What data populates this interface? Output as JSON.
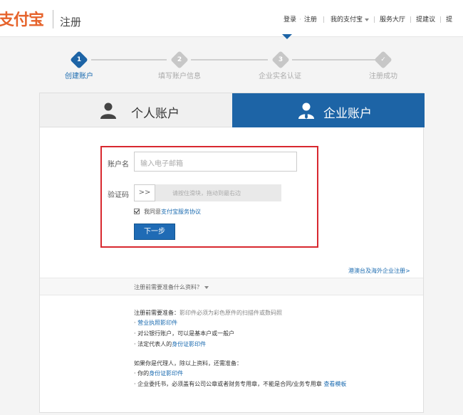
{
  "header": {
    "logo": "支付宝",
    "page_name": "注册",
    "nav": {
      "login": "登录",
      "register": "注册",
      "my_alipay": "我的支付宝",
      "service_hall": "服务大厅",
      "suggestion": "提建议",
      "cut": "提"
    }
  },
  "steps": [
    {
      "num": "1",
      "label": "创建账户",
      "state": "active"
    },
    {
      "num": "2",
      "label": "填写账户信息",
      "state": "pending"
    },
    {
      "num": "3",
      "label": "企业实名认证",
      "state": "pending"
    },
    {
      "num": "✓",
      "label": "注册成功",
      "state": "pending"
    }
  ],
  "tabs": {
    "personal": "个人账户",
    "company": "企业账户"
  },
  "form": {
    "account_label": "账户名",
    "account_placeholder": "输入电子邮箱",
    "captcha_label": "验证码",
    "slider_handle": ">>",
    "slider_hint": "请按住滑块，拖动到最右边",
    "agree_prefix": "我同意",
    "agree_link": "支付宝服务协议",
    "agree_checked": true,
    "next_button": "下一步"
  },
  "links": {
    "overseas": "港澳台及海外企业注册>"
  },
  "prep": {
    "toggle": "注册前需要准备什么资料？",
    "title": "注册前需要准备：",
    "note": "影印件必须为彩色原件的扫描件或数码照",
    "item1": "营业执照影印件",
    "item2": "对公银行账户，可以是基本户或一般户",
    "item3_prefix": "法定代表人的",
    "item3_link": "身份证影印件",
    "agent_title": "如果你是代理人，除以上资料，还需准备：",
    "agent_item1_prefix": "你的",
    "agent_item1_link": "身份证影印件",
    "agent_item2": "企业委托书，必须盖有公司公章或者财务专用章，不能是合同/业务专用章",
    "agent_item2_link": "查看模板"
  },
  "colors": {
    "brand_orange": "#e6632b",
    "primary_blue": "#1d64a6",
    "highlight_red": "#d8282f",
    "link_blue": "#1b6bb0"
  }
}
